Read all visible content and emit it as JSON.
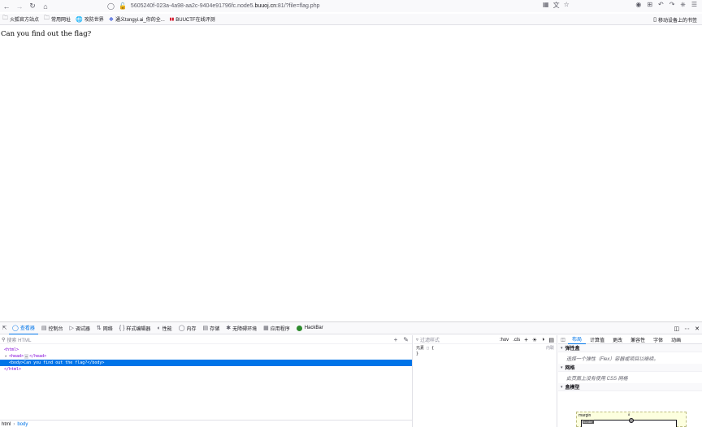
{
  "browser": {
    "url_prefix": "5605240f-023a-4a98-aa2c-9404e91796fc.node5.",
    "url_domain": "buuoj.cn",
    "url_suffix": ":81/?file=flag.php",
    "bookmarks": [
      {
        "label": "火狐官方站点",
        "icon": "folder-icon"
      },
      {
        "label": "常用网址",
        "icon": "folder-icon"
      },
      {
        "label": "攻防世界",
        "icon": "globe-icon"
      },
      {
        "label": "通义tongyi.ai_你的全...",
        "icon": "tongyi-icon"
      },
      {
        "label": "BUUCTF在线评测",
        "icon": "buuctf-icon"
      }
    ],
    "mobile_bookmarks": "移动设备上的书签"
  },
  "page": {
    "text": "Can you find out the flag?"
  },
  "devtools": {
    "tabs": [
      {
        "label": "查看器",
        "icon": "inspector-icon",
        "active": true
      },
      {
        "label": "控制台",
        "icon": "console-icon",
        "active": false
      },
      {
        "label": "调试器",
        "icon": "debugger-icon",
        "active": false
      },
      {
        "label": "网络",
        "icon": "network-icon",
        "active": false
      },
      {
        "label": "样式编辑器",
        "icon": "style-editor-icon",
        "active": false
      },
      {
        "label": "性能",
        "icon": "performance-icon",
        "active": false
      },
      {
        "label": "内存",
        "icon": "memory-icon",
        "active": false
      },
      {
        "label": "存储",
        "icon": "storage-icon",
        "active": false
      },
      {
        "label": "无障碍环境",
        "icon": "accessibility-icon",
        "active": false
      },
      {
        "label": "应用程序",
        "icon": "application-icon",
        "active": false
      },
      {
        "label": "HackBar",
        "icon": "hackbar-icon",
        "active": false
      }
    ],
    "markup": {
      "search_placeholder": "搜索 HTML",
      "lines": {
        "html_open": "<html>",
        "head": "<head>",
        "head_ellipsis": "…",
        "head_close": "</head>",
        "body": "<body>Can you find out the flag?</body>",
        "html_close": "</html>"
      },
      "breadcrumbs": [
        "html",
        "body"
      ]
    },
    "rules": {
      "filter_placeholder": "过滤样式",
      "hov": ":hov",
      "cls": ".cls",
      "element_label": "元素",
      "open_brace": "{",
      "close_brace": "}",
      "inline_label": "内联"
    },
    "layout": {
      "tabs": [
        "布局",
        "计算值",
        "更改",
        "兼容性",
        "字体",
        "动画"
      ],
      "active_tab": "布局",
      "flex_header": "弹性盒",
      "flex_text": "选择一个弹性（Flex）容器或项目以继续。",
      "grid_header": "网格",
      "grid_text": "此页面上没有使用 CSS 网格",
      "boxmodel_header": "盒模型",
      "margin_label": "margin",
      "margin_value": "8",
      "border_label": "border"
    },
    "colors": {
      "accent": "#0074e8",
      "selected_bg": "#0074e8",
      "hackbar_dot": "#2e8b2e"
    }
  }
}
